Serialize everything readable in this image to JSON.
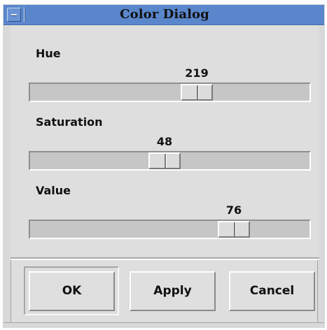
{
  "window": {
    "title": "Color Dialog"
  },
  "sliders": [
    {
      "label": "Hue",
      "value": "219",
      "min": 0,
      "max": 360,
      "position_fraction": 0.61
    },
    {
      "label": "Saturation",
      "value": "48",
      "min": 0,
      "max": 100,
      "position_fraction": 0.48
    },
    {
      "label": "Value",
      "value": "76",
      "min": 0,
      "max": 100,
      "position_fraction": 0.76
    }
  ],
  "buttons": {
    "ok": "OK",
    "apply": "Apply",
    "cancel": "Cancel"
  },
  "icons": {
    "window_menu": "window-menu-icon"
  },
  "colors": {
    "titlebar": "#5a87cc",
    "window_bg": "#dedede",
    "track_bg": "#c6c6c6"
  }
}
